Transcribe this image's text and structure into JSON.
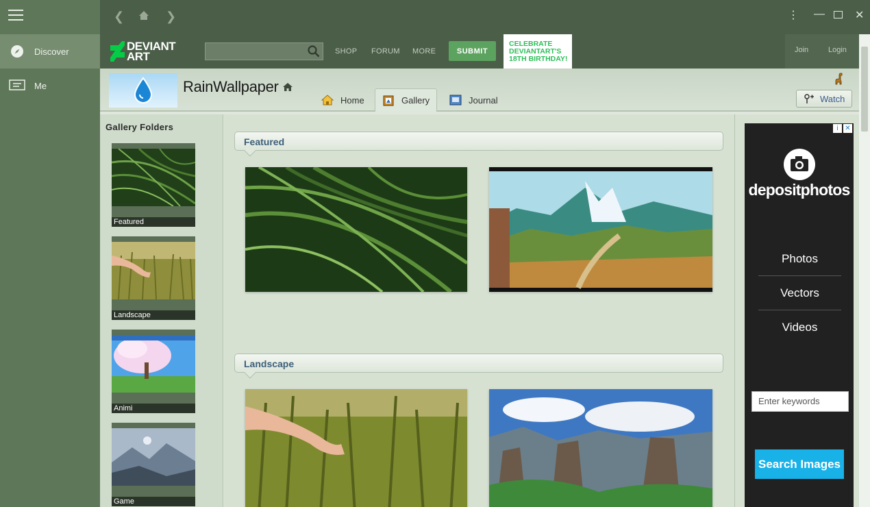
{
  "app_nav": {
    "items": [
      {
        "label": "Discover",
        "icon": "compass-icon"
      },
      {
        "label": "Me",
        "icon": "screen-icon"
      }
    ]
  },
  "header": {
    "logo_line1": "DEVIANT",
    "logo_line2": "ART",
    "search_placeholder": "",
    "links": [
      "SHOP",
      "FORUM",
      "MORE"
    ],
    "submit_label": "SUBMIT",
    "promo_lines": [
      "CELEBRATE",
      "DEVIANTART'S",
      "18TH BIRTHDAY!"
    ],
    "join_label": "Join",
    "login_label": "Login"
  },
  "profile": {
    "name": "RainWallpaper",
    "tabs": [
      {
        "label": "Home",
        "icon": "home-icon"
      },
      {
        "label": "Gallery",
        "icon": "gallery-icon"
      },
      {
        "label": "Journal",
        "icon": "journal-icon"
      }
    ],
    "active_tab": "Gallery",
    "watch_label": "Watch"
  },
  "sidebar": {
    "title": "Gallery Folders",
    "folders": [
      {
        "label": "Featured"
      },
      {
        "label": "Landscape"
      },
      {
        "label": "Animi"
      },
      {
        "label": "Game"
      }
    ]
  },
  "gallery": {
    "sections": [
      {
        "title": "Featured"
      },
      {
        "title": "Landscape"
      }
    ]
  },
  "ad": {
    "brand": "depositphotos",
    "menu": [
      "Photos",
      "Vectors",
      "Videos"
    ],
    "input_placeholder": "Enter keywords",
    "button_label": "Search Images"
  },
  "colors": {
    "nav_bg": "#5f7759",
    "header_bg": "#4a5e48",
    "submit_green": "#5da360",
    "ad_button": "#18b1e8"
  }
}
